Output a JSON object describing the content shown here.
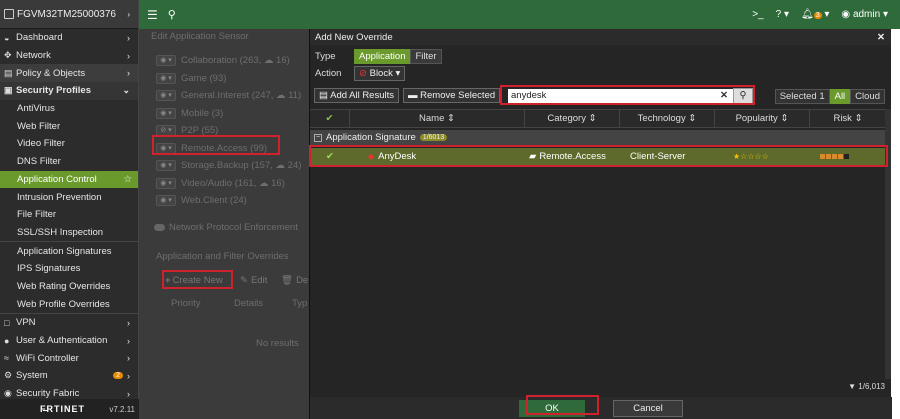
{
  "device": "FGVM32TM25000376",
  "brand": "F̶RTINET",
  "version": "v7.2.11",
  "topbar": {
    "cli": ">_",
    "help": "?",
    "alerts": "3",
    "user": "admin"
  },
  "sidebar": [
    {
      "label": "Dashboard",
      "icon": "◒",
      "kind": "top",
      "arrow": "›"
    },
    {
      "label": "Network",
      "icon": "✥",
      "kind": "top",
      "arrow": "›"
    },
    {
      "label": "Policy & Objects",
      "icon": "▤",
      "kind": "hl",
      "arrow": "›"
    },
    {
      "label": "Security Profiles",
      "icon": "▣",
      "kind": "open",
      "arrow": "⌄"
    },
    {
      "label": "AntiVirus",
      "kind": "sub"
    },
    {
      "label": "Web Filter",
      "kind": "sub"
    },
    {
      "label": "Video Filter",
      "kind": "sub"
    },
    {
      "label": "DNS Filter",
      "kind": "sub"
    },
    {
      "label": "Application Control",
      "kind": "active"
    },
    {
      "label": "Intrusion Prevention",
      "kind": "sub"
    },
    {
      "label": "File Filter",
      "kind": "sub"
    },
    {
      "label": "SSL/SSH Inspection",
      "kind": "sub"
    },
    {
      "label": "Application Signatures",
      "kind": "sub"
    },
    {
      "label": "IPS Signatures",
      "kind": "sub"
    },
    {
      "label": "Web Rating Overrides",
      "kind": "sub"
    },
    {
      "label": "Web Profile Overrides",
      "kind": "sub"
    },
    {
      "label": "VPN",
      "icon": "□",
      "kind": "top",
      "arrow": "›"
    },
    {
      "label": "User & Authentication",
      "icon": "●",
      "kind": "top",
      "arrow": "›"
    },
    {
      "label": "WiFi Controller",
      "icon": "≈",
      "kind": "top",
      "arrow": "›"
    },
    {
      "label": "System",
      "icon": "⚙",
      "kind": "top",
      "badge": "2",
      "arrow": "›"
    },
    {
      "label": "Security Fabric",
      "icon": "◉",
      "kind": "top",
      "arrow": "›"
    }
  ],
  "bg": {
    "header": "Edit Application Sensor",
    "rows": [
      "Collaboration (263, ☁ 16)",
      "Game (93)",
      "General.Interest (247, ☁ 11)",
      "Mobile (3)",
      "P2P (55)",
      "Remote.Access (99)",
      "Storage.Backup (157, ☁ 24)",
      "Video/Audio (161, ☁ 16)",
      "Web.Client (24)"
    ],
    "npe": "Network Protocol Enforcement",
    "overrides": "Application and Filter Overrides",
    "create": "Create New",
    "edit": "Edit",
    "del": "De",
    "cols": [
      "Priority",
      "Details",
      "Typ"
    ],
    "noresults": "No results"
  },
  "modal": {
    "title": "Add New Override",
    "type_label": "Type",
    "type_opts": [
      "Application",
      "Filter"
    ],
    "action_label": "Action",
    "action_value": "Block",
    "add_all": "Add All Results",
    "remove_sel": "Remove Selected",
    "search": "anydesk",
    "selected_label": "Selected",
    "selected_count": "1",
    "seg": [
      "All",
      "Cloud"
    ],
    "columns": [
      "Name",
      "Category",
      "Technology",
      "Popularity",
      "Risk"
    ],
    "group": "Application Signature",
    "group_count": "1/6013",
    "row": {
      "name": "AnyDesk",
      "category": "Remote.Access",
      "technology": "Client-Server",
      "popularity": "★☆☆☆☆"
    },
    "count": "1/6,013",
    "ok": "OK",
    "cancel": "Cancel"
  }
}
